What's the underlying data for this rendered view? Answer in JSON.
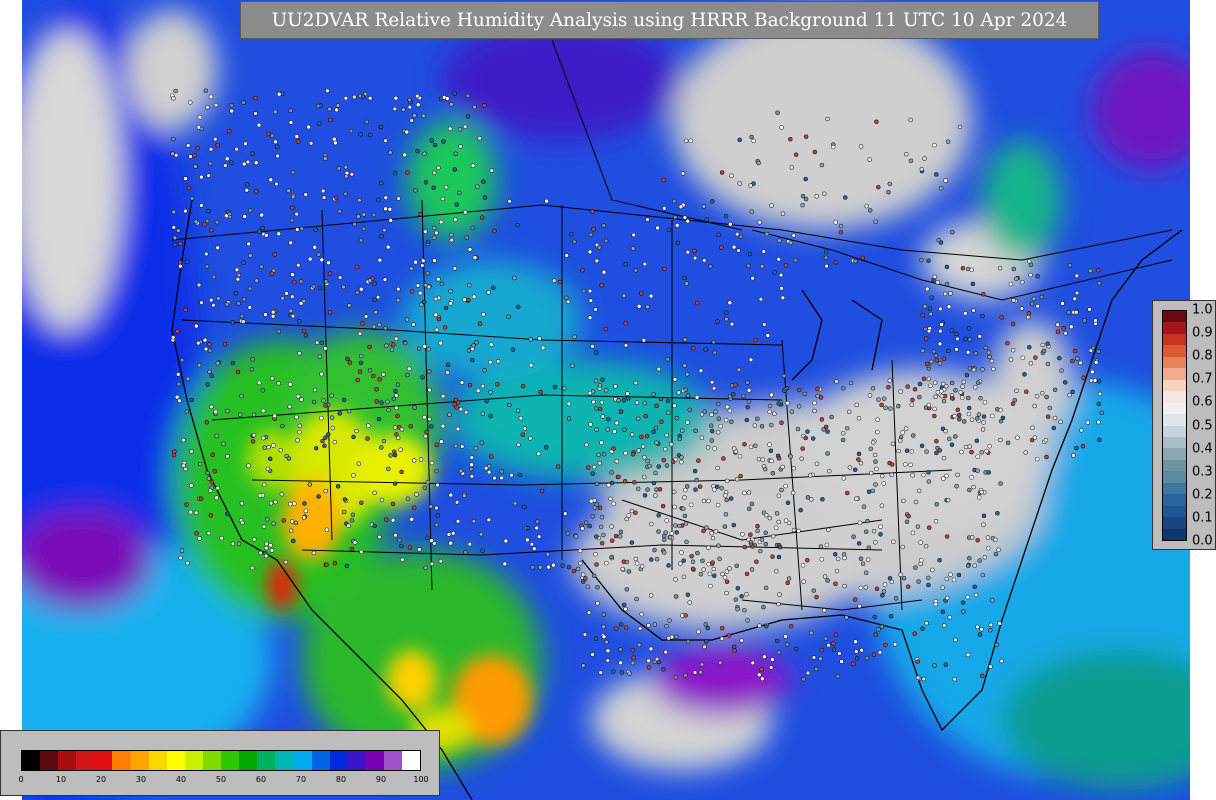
{
  "title": "UU2DVAR Relative Humidity Analysis using HRRR Background 11 UTC 10 Apr 2024",
  "map": {
    "field": "relative humidity",
    "region": "CONUS",
    "features": [
      "coastlines",
      "state-borders",
      "country-borders",
      "observation-stations"
    ]
  },
  "bottom_colorbar": {
    "ticks": [
      "0",
      "10",
      "20",
      "30",
      "40",
      "50",
      "60",
      "70",
      "80",
      "90",
      "100"
    ],
    "colors": [
      "#000000",
      "#5a0a0a",
      "#a80c0c",
      "#d41515",
      "#e01010",
      "#ff7f00",
      "#ffa500",
      "#ffd700",
      "#ffff00",
      "#c8f000",
      "#7fdc00",
      "#2cc800",
      "#00a800",
      "#00b060",
      "#00b4b4",
      "#00aaf0",
      "#0064e6",
      "#0028dc",
      "#3c14c8",
      "#7800b4",
      "#a050c8",
      "#ffffff"
    ]
  },
  "right_colorbar": {
    "ticks": [
      "1.0",
      "0.9",
      "0.8",
      "0.7",
      "0.6",
      "0.5",
      "0.4",
      "0.3",
      "0.2",
      "0.1",
      "0.0"
    ],
    "colors": [
      "#6b0a12",
      "#a8141e",
      "#c8321e",
      "#dc5a32",
      "#e6825a",
      "#f0aa8c",
      "#f8d2c0",
      "#f5e6e0",
      "#f0f0f0",
      "#dfe6ea",
      "#c8d4dc",
      "#aabcc8",
      "#8ca6b4",
      "#6e94a0",
      "#5a8ca0",
      "#3c78a0",
      "#2864a0",
      "#1e5596",
      "#164680",
      "#0e3770"
    ]
  }
}
